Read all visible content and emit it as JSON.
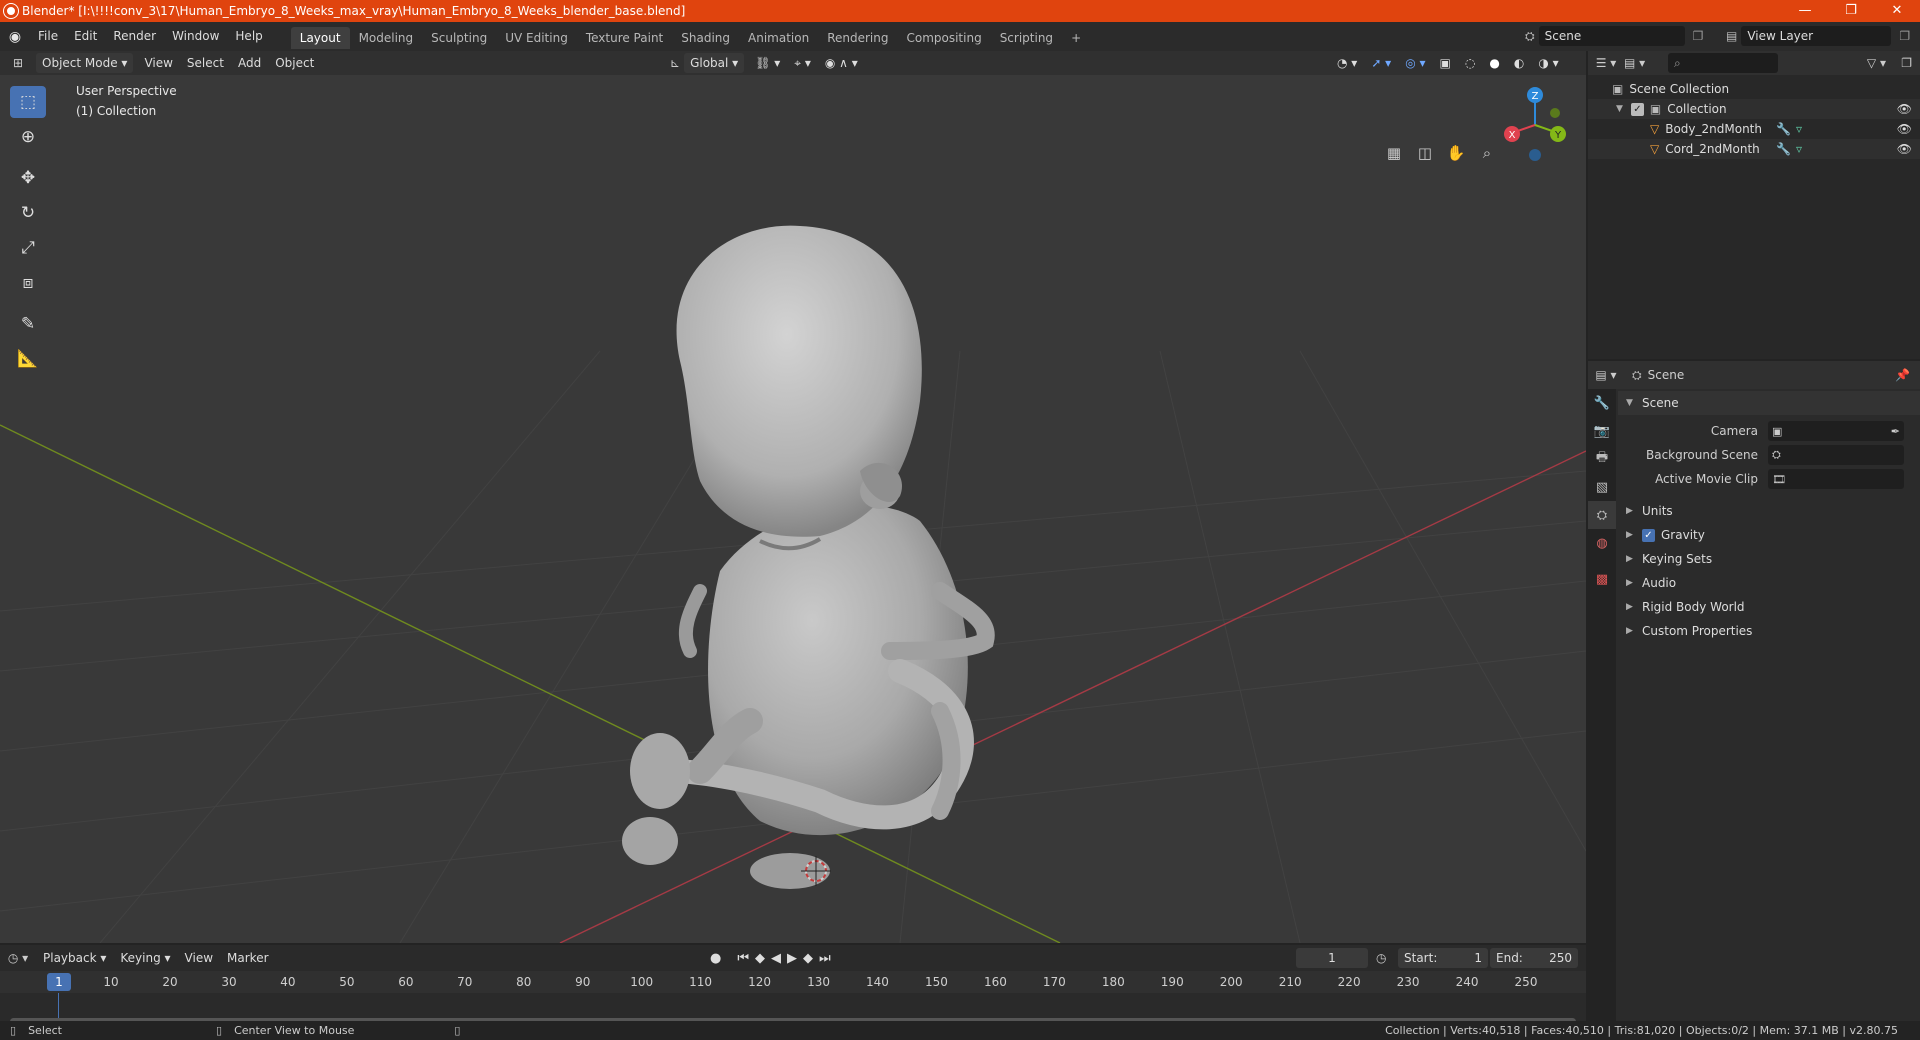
{
  "window": {
    "title": "Blender* [I:\\!!!!conv_3\\17\\Human_Embryo_8_Weeks_max_vray\\Human_Embryo_8_Weeks_blender_base.blend]",
    "minimize": "—",
    "maximize": "❐",
    "close": "✕"
  },
  "menu": {
    "items": [
      "File",
      "Edit",
      "Render",
      "Window",
      "Help"
    ]
  },
  "workspaces": [
    "Layout",
    "Modeling",
    "Sculpting",
    "UV Editing",
    "Texture Paint",
    "Shading",
    "Animation",
    "Rendering",
    "Compositing",
    "Scripting"
  ],
  "workspace_add": "+",
  "scene_field": "Scene",
  "view_layer_field": "View Layer",
  "viewport_header": {
    "mode": "Object Mode",
    "menus": [
      "View",
      "Select",
      "Add",
      "Object"
    ],
    "orientation": "Global"
  },
  "viewport": {
    "perspective": "User Perspective",
    "collection": "(1) Collection",
    "gizmo": {
      "x": "X",
      "y": "Y",
      "z": "Z"
    }
  },
  "timeline": {
    "menus": [
      "Playback",
      "Keying",
      "View",
      "Marker"
    ],
    "current_frame": "1",
    "start_label": "Start:",
    "start": "1",
    "end_label": "End:",
    "end": "250",
    "ruler": [
      "1",
      "10",
      "20",
      "30",
      "40",
      "50",
      "60",
      "70",
      "80",
      "90",
      "100",
      "110",
      "120",
      "130",
      "140",
      "150",
      "160",
      "170",
      "180",
      "190",
      "200",
      "210",
      "220",
      "230",
      "240",
      "250"
    ]
  },
  "status": {
    "left1": "Select",
    "left2": "Center View to Mouse",
    "right": "Collection | Verts:40,518 | Faces:40,510 | Tris:81,020 | Objects:0/2 | Mem: 37.1 MB | v2.80.75"
  },
  "outliner": {
    "scene_collection": "Scene Collection",
    "collection": "Collection",
    "objects": [
      "Body_2ndMonth",
      "Cord_2ndMonth"
    ]
  },
  "properties": {
    "header": "Scene",
    "section": "Scene",
    "camera_label": "Camera",
    "bg_scene_label": "Background Scene",
    "movie_clip_label": "Active Movie Clip",
    "panels": [
      "Units",
      "Gravity",
      "Keying Sets",
      "Audio",
      "Rigid Body World",
      "Custom Properties"
    ]
  },
  "colors": {
    "title_bar": "#e0440e",
    "accent": "#4772b3",
    "x_axis": "#e0424f",
    "y_axis": "#84b817",
    "z_axis": "#2e8bdb"
  }
}
